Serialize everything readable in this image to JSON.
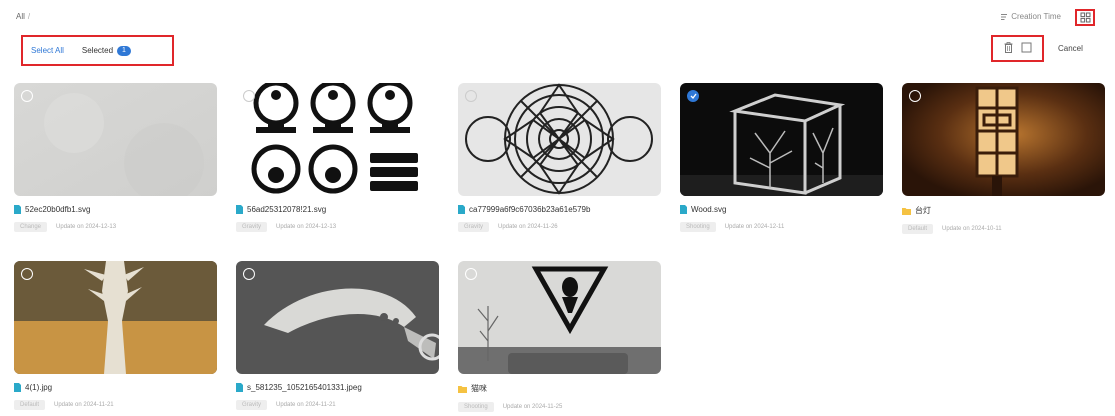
{
  "header": {
    "breadcrumb": "All",
    "sort_label": "Creation Time"
  },
  "selection": {
    "select_all": "Select All",
    "selected_label": "Selected",
    "selected_count": "1",
    "cancel": "Cancel"
  },
  "colors": {
    "accent": "#2f78d6",
    "highlight": "#e0262a",
    "file_icon": "#2aa9c9",
    "folder_icon": "#f5c242"
  },
  "items": [
    {
      "name": "52ec20b0dfb1.svg",
      "type": "file",
      "tag": "Change",
      "updated": "Update on 2024-12-13",
      "selected": false
    },
    {
      "name": "56ad25312078!21.svg",
      "type": "file",
      "tag": "Gravity",
      "updated": "Update on 2024-12-13",
      "selected": false
    },
    {
      "name": "ca77999a6f9c67036b23a61e579b",
      "type": "file",
      "tag": "Gravity",
      "updated": "Update on 2024-11-26",
      "selected": false
    },
    {
      "name": "Wood.svg",
      "type": "file",
      "tag": "Shooting",
      "updated": "Update on 2024-12-11",
      "selected": true
    },
    {
      "name": "台灯",
      "type": "folder",
      "tag": "Default",
      "updated": "Update on 2024-10-11",
      "selected": false
    },
    {
      "name": "4(1).jpg",
      "type": "file",
      "tag": "Default",
      "updated": "Update on 2024-11-21",
      "selected": false
    },
    {
      "name": "s_581235_1052165401331.jpeg",
      "type": "file",
      "tag": "Gravity",
      "updated": "Update on 2024-11-21",
      "selected": false
    },
    {
      "name": "猫咪",
      "type": "folder",
      "tag": "Shooting",
      "updated": "Update on 2024-11-25",
      "selected": false
    }
  ]
}
